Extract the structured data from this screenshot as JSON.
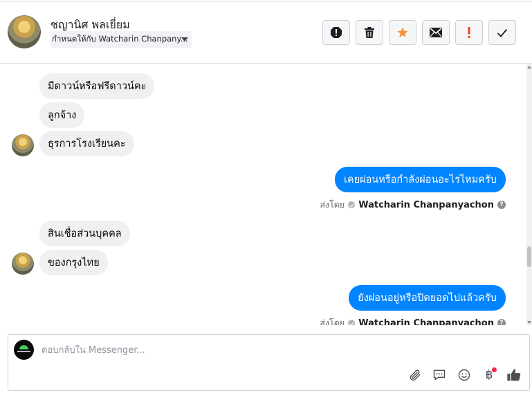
{
  "header": {
    "contact_name": "ชญานิศ พลเยี่ยม",
    "assigned_to": "กำหนดให้กับ Watcharin Chanpany..."
  },
  "toolbar": {
    "icons": [
      "spam-report-icon",
      "trash-icon",
      "star-icon",
      "envelope-icon",
      "exclamation-icon",
      "checkmark-icon"
    ],
    "star_color": "#f7923b",
    "exclamation_color": "#e9402b"
  },
  "messages": [
    {
      "direction": "in",
      "text": "มีดาวน์หรือฟรีดาวน์คะ"
    },
    {
      "direction": "in",
      "text": "ลูกจ้าง"
    },
    {
      "direction": "in",
      "text": "ธุรการโรงเรียนคะ"
    },
    {
      "direction": "out",
      "text": "เคยผ่อนหรือกำลังผ่อนอะไรไหมครับ",
      "sent_by_label": "ส่งโดย",
      "agent": "Watcharin Chanpanyachon"
    },
    {
      "direction": "in",
      "text": "สินเชื่อส่วนบุคคล"
    },
    {
      "direction": "in",
      "text": "ของกรุงไทย"
    },
    {
      "direction": "out",
      "text": "ยังผ่อนอยู่หรือปิดยอดไปแล้วครับ",
      "sent_by_label": "ส่งโดย",
      "agent": "Watcharin Chanpanyachon"
    }
  ],
  "composer": {
    "placeholder": "ตอบกลับใน Messenger...",
    "icons": [
      "paperclip-icon",
      "saved-reply-icon",
      "emoji-icon",
      "baht-payment-icon",
      "thumbs-up-icon"
    ],
    "accent_color": "#0084ff"
  },
  "colors": {
    "outgoing_bubble": "#0084ff",
    "incoming_bubble": "#f0f0f0"
  }
}
